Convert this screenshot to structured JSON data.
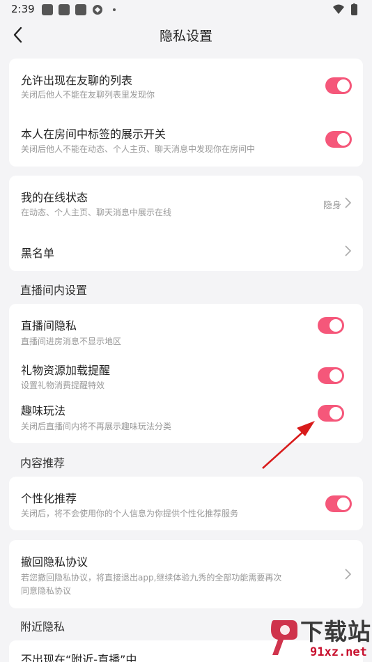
{
  "status_bar": {
    "time": "2:39"
  },
  "header": {
    "title": "隐私设置"
  },
  "card1": {
    "items": [
      {
        "title": "允许出现在友聊的列表",
        "subtitle": "关闭后他人不能在友聊列表里发现你"
      },
      {
        "title": "本人在房间中标签的展示开关",
        "subtitle": "关闭后他人不能在动态、个人主页、聊天消息中发现你在房间中"
      }
    ]
  },
  "card2": {
    "online_status": {
      "title": "我的在线状态",
      "subtitle": "在动态、个人主页、聊天消息中展示在线",
      "value": "隐身"
    },
    "blacklist": {
      "title": "黑名单"
    }
  },
  "live_section": {
    "label": "直播间内设置",
    "items": [
      {
        "title": "直播间隐私",
        "subtitle": "直播间进房消息不显示地区"
      },
      {
        "title": "礼物资源加载提醒",
        "subtitle": "设置礼物消费提醒特效"
      },
      {
        "title": "趣味玩法",
        "subtitle": "关闭后直播间内将不再展示趣味玩法分类"
      }
    ]
  },
  "content_section": {
    "label": "内容推荐",
    "item": {
      "title": "个性化推荐",
      "subtitle": "关闭后，将不会使用你的个人信息为你提供个性化推荐服务"
    }
  },
  "revoke": {
    "title": "撤回隐私协议",
    "subtitle_line1": "若您撤回隐私协议，将直接退出app,继续体验九秀的全部功能需要再次",
    "subtitle_line2": "同意隐私协议"
  },
  "nearby_section": {
    "label": "附近隐私",
    "item": {
      "title": "不出现在“附近-直播”中"
    }
  },
  "watermark": {
    "text_big": "下载站",
    "text_small": "91xz.net"
  },
  "colors": {
    "accent": "#f5577a",
    "annotation_arrow": "#d81b1b"
  }
}
